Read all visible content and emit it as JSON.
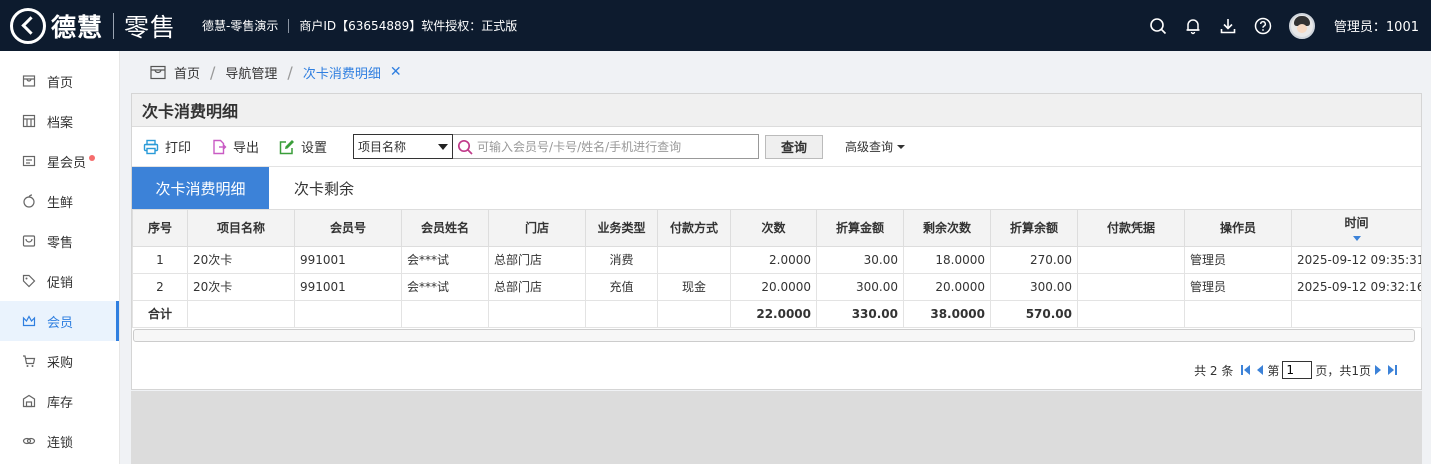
{
  "header": {
    "brand": "德慧",
    "product": "零售",
    "store": "德慧-零售演示",
    "merchant": "商户ID【63654889】软件授权：正式版",
    "admin": "管理员：1001"
  },
  "sidebar": {
    "items": [
      {
        "label": "首页",
        "icon": "store-icon"
      },
      {
        "label": "档案",
        "icon": "archive-icon"
      },
      {
        "label": "星会员",
        "icon": "vip-card-icon"
      },
      {
        "label": "生鲜",
        "icon": "apple-icon"
      },
      {
        "label": "零售",
        "icon": "register-icon"
      },
      {
        "label": "促销",
        "icon": "tag-icon"
      },
      {
        "label": "会员",
        "icon": "crown-icon"
      },
      {
        "label": "采购",
        "icon": "cart-icon"
      },
      {
        "label": "库存",
        "icon": "warehouse-icon"
      },
      {
        "label": "连锁",
        "icon": "chain-icon"
      }
    ],
    "active": "会员"
  },
  "breadcrumb": {
    "home": "首页",
    "nav": "导航管理",
    "current": "次卡消费明细",
    "close": "✕"
  },
  "panel": {
    "title": "次卡消费明细",
    "toolbar": {
      "print": "打印",
      "export": "导出",
      "settings": "设置",
      "select_value": "项目名称",
      "search_placeholder": "可输入会员号/卡号/姓名/手机进行查询",
      "query": "查询",
      "advanced": "高级查询"
    },
    "tabs": [
      "次卡消费明细",
      "次卡剩余"
    ]
  },
  "table": {
    "columns": [
      "序号",
      "项目名称",
      "会员号",
      "会员姓名",
      "门店",
      "业务类型",
      "付款方式",
      "次数",
      "折算金额",
      "剩余次数",
      "折算余额",
      "付款凭据",
      "操作员",
      "时间"
    ],
    "rows": [
      [
        "1",
        "20次卡",
        "991001",
        "会***试",
        "总部门店",
        "消费",
        "",
        "2.0000",
        "30.00",
        "18.0000",
        "270.00",
        "",
        "管理员",
        "2025-09-12 09:35:31"
      ],
      [
        "2",
        "20次卡",
        "991001",
        "会***试",
        "总部门店",
        "充值",
        "现金",
        "20.0000",
        "300.00",
        "20.0000",
        "300.00",
        "",
        "管理员",
        "2025-09-12 09:32:16"
      ]
    ],
    "summary": {
      "label": "合计",
      "count": "22.0000",
      "amount": "330.00",
      "remain_count": "38.0000",
      "remain_amount": "570.00"
    }
  },
  "pager": {
    "total": "共 2 条",
    "page_prefix": "第",
    "page_value": "1",
    "page_suffix": "页，共1页"
  }
}
